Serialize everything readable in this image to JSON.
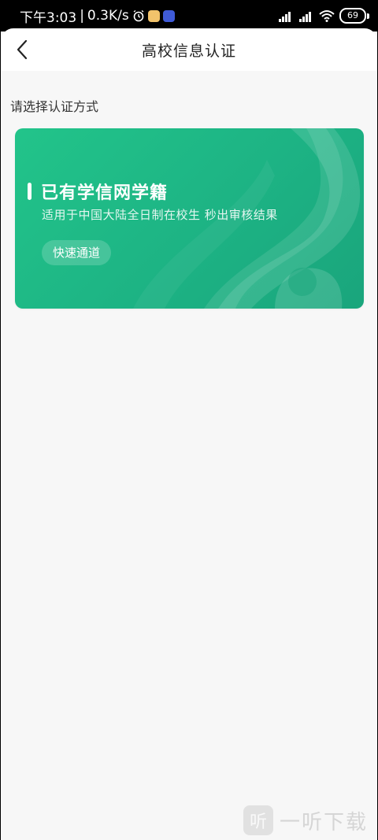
{
  "status_bar": {
    "time": "下午3:03",
    "network_speed": "0.3K/s",
    "battery": "69",
    "icons": [
      "alarm-icon",
      "app-notification-icon",
      "app-notification-icon",
      "signal-icon",
      "signal-icon",
      "wifi-icon",
      "battery-icon"
    ]
  },
  "header": {
    "title": "高校信息认证",
    "back_icon": "chevron-left-icon"
  },
  "section_label": "请选择认证方式",
  "card": {
    "title": "已有学信网学籍",
    "subtitle": "适用于中国大陆全日制在校生 秒出审核结果",
    "button_label": "快速通道",
    "accent_color": "#1fb886"
  },
  "watermark": {
    "text": "一听下载",
    "icon_glyph": "听"
  }
}
